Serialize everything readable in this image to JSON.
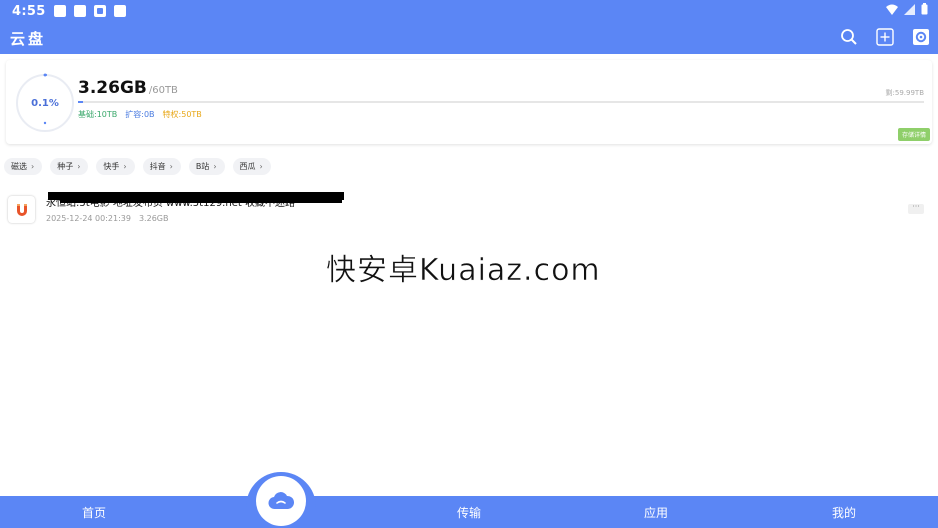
{
  "status_bar": {
    "time": "4:55"
  },
  "app": {
    "title": "云盘"
  },
  "toolbar_icons": [
    "search-icon",
    "add-icon",
    "settings-icon"
  ],
  "storage": {
    "percent_label": "0.1%",
    "used_fraction": 0.001,
    "used": "3.26GB",
    "total": "/60TB",
    "remaining": "剩:59.99TB",
    "base": "基础:10TB",
    "expand": "扩容:0B",
    "privilege": "特权:50TB",
    "detail_label": "存储详情"
  },
  "categories": [
    "磁选",
    "种子",
    "快手",
    "抖音",
    "B站",
    "西瓜"
  ],
  "files": [
    {
      "name": "永恒站:5t电影 地址发布页 www.5t129.net 收藏不迷路",
      "date": "2025-12-24 00:21:39",
      "size": "3.26GB",
      "more": "···"
    }
  ],
  "watermark": "快安卓Kuaiaz.com",
  "bottom_nav": {
    "home": "首页",
    "transfer": "传输",
    "apps": "应用",
    "mine": "我的"
  },
  "colors": {
    "primary": "#5b86f5",
    "base": "#3aa86b",
    "expand": "#4a7be0",
    "privilege": "#e8a81a",
    "badge": "#8fcf6a"
  }
}
